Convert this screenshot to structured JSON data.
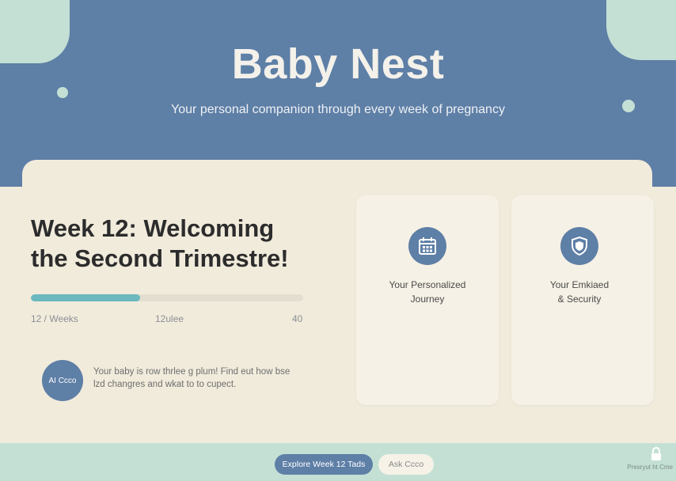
{
  "header": {
    "title": "Baby Nest",
    "tagline": "Your personal companion through every week of pregnancy"
  },
  "week": {
    "heading": "Week 12: Welcoming the Second Trimestre!",
    "progress_fraction": 0.4,
    "progress_labels": {
      "start": "12 / Weeks",
      "middle": "12ulee",
      "end": "40"
    }
  },
  "assistant": {
    "avatar_text": "AI Ccco",
    "message": "Your baby is row thrlee g plum! Find eut how bse lzd changres and wkat to to cupect."
  },
  "features": [
    {
      "icon": "calendar-icon",
      "label": "Your Personalized\nJourney"
    },
    {
      "icon": "shield-icon",
      "label": "Your Emkiaed\n& Security"
    }
  ],
  "footer": {
    "primary_button": "Explore Week 12 Tads",
    "secondary_button": "Ask Ccco",
    "privacy_note": "Presryut ht Cme"
  },
  "colors": {
    "brand_blue": "#5e7fa6",
    "mint": "#c4e0d5",
    "cream": "#f1ebdc",
    "progress_teal": "#6bb8bf"
  }
}
